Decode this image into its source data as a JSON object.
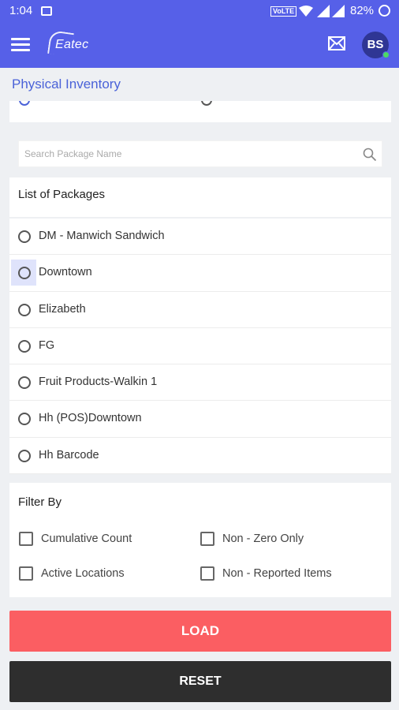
{
  "status_bar": {
    "time": "1:04",
    "network_badge": "VoLTE",
    "battery": "82%"
  },
  "app_bar": {
    "logo_text": "Eatec",
    "user_initials": "BS",
    "status_color": "#4cd964"
  },
  "colors": {
    "primary": "#5660e8",
    "title": "#4a62d8",
    "load": "#fb5e62",
    "reset": "#2e2e2e"
  },
  "page": {
    "title": "Physical Inventory"
  },
  "search": {
    "placeholder": "Search Package Name",
    "value": ""
  },
  "packages": {
    "heading": "List of Packages",
    "items": [
      {
        "label": "DM - Manwich Sandwich",
        "selected": false
      },
      {
        "label": "Downtown",
        "selected": false,
        "highlighted": true
      },
      {
        "label": "Elizabeth",
        "selected": false
      },
      {
        "label": "FG",
        "selected": false
      },
      {
        "label": "Fruit Products-Walkin 1",
        "selected": false
      },
      {
        "label": "Hh (POS)Downtown",
        "selected": false
      },
      {
        "label": "Hh Barcode",
        "selected": false
      }
    ]
  },
  "filter": {
    "heading": "Filter By",
    "options": [
      {
        "label": "Cumulative Count",
        "checked": false
      },
      {
        "label": "Non - Zero Only",
        "checked": false
      },
      {
        "label": "Active Locations",
        "checked": false
      },
      {
        "label": "Non - Reported Items",
        "checked": false
      }
    ]
  },
  "buttons": {
    "load": "LOAD",
    "reset": "RESET"
  },
  "icons": [
    "hamburger-icon",
    "mail-icon",
    "search-icon",
    "wifi-icon",
    "signal-icon",
    "battery-icon",
    "gallery-icon"
  ]
}
